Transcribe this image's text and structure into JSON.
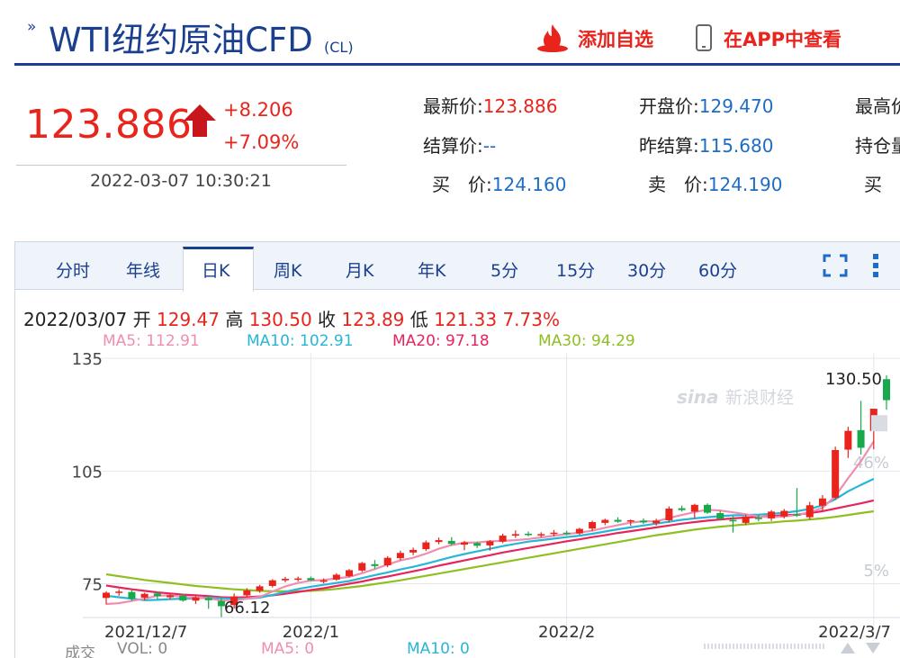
{
  "header": {
    "title": "WTI纽约原油CFD",
    "code": "(CL)",
    "add_watchlist": "添加自选",
    "view_in_app": "在APP中查看"
  },
  "quote": {
    "price": "123.886",
    "change": "+8.206",
    "change_pct": "+7.09%",
    "timestamp": "2022-03-07 10:30:21",
    "fields": [
      {
        "label": "最新价:",
        "value": "123.886",
        "red": true
      },
      {
        "label": "开盘价:",
        "value": "129.470",
        "red": false
      },
      {
        "label": "最高价",
        "value": "",
        "red": false
      },
      {
        "label": "结算价:",
        "value": "--",
        "red": false
      },
      {
        "label": "昨结算:",
        "value": "115.680",
        "red": false
      },
      {
        "label": "持仓量",
        "value": "",
        "red": false
      },
      {
        "label": "买　价:",
        "value": "124.160",
        "red": false
      },
      {
        "label": "卖　价:",
        "value": "124.190",
        "red": false
      },
      {
        "label": "买　量",
        "value": "",
        "red": false
      }
    ]
  },
  "tabs": [
    "分时",
    "年线",
    "日K",
    "周K",
    "月K",
    "年K",
    "5分",
    "15分",
    "30分",
    "60分"
  ],
  "active_tab": "日K",
  "icons": {
    "fullscreen": "fullscreen-icon",
    "more": "more-vertical-icon",
    "fire": "fire-icon",
    "phone": "phone-icon",
    "arrow": "up-arrow-icon"
  },
  "ohlc": {
    "date": "2022/03/07",
    "open_label": "开",
    "open": "129.47",
    "high_label": "高",
    "high": "130.50",
    "close_label": "收",
    "close": "123.89",
    "low_label": "低",
    "low": "121.33",
    "change_pct": "7.73%"
  },
  "ma_legend": [
    {
      "label": "MA5: 112.91",
      "color": "#f08eb0"
    },
    {
      "label": "MA10: 102.91",
      "color": "#27b6d6"
    },
    {
      "label": "MA20: 97.18",
      "color": "#e8245d"
    },
    {
      "label": "MA30: 94.29",
      "color": "#8fbf21"
    }
  ],
  "volume_legend": [
    {
      "label": "成交",
      "color": "#888888"
    },
    {
      "label": "VOL: 0",
      "color": "#888888"
    },
    {
      "label": "MA5: 0",
      "color": "#f08eb0"
    },
    {
      "label": "MA10: 0",
      "color": "#27b6d6"
    }
  ],
  "watermark": "新浪财经",
  "colors": {
    "up": "#e8241c",
    "down": "#18a94a",
    "brand": "#1b3f8f",
    "link": "#1f6cc5"
  },
  "chart_data": {
    "type": "candlestick",
    "y_ticks": [
      75,
      105,
      135
    ],
    "y_range": [
      66,
      136
    ],
    "pct_labels": [
      "46%",
      "5%"
    ],
    "x_labels": [
      {
        "label": "2021/12/7",
        "index": 0
      },
      {
        "label": "2022/1",
        "index": 16
      },
      {
        "label": "2022/2",
        "index": 36
      },
      {
        "label": "2022/3/7",
        "index": 60
      }
    ],
    "max_label": "130.50",
    "min_label": "66.12",
    "min_index": 9,
    "candles": [
      {
        "o": 71.2,
        "h": 73.0,
        "l": 69.5,
        "c": 72.6
      },
      {
        "o": 72.6,
        "h": 73.5,
        "l": 71.8,
        "c": 72.9
      },
      {
        "o": 72.8,
        "h": 73.4,
        "l": 70.4,
        "c": 71.0
      },
      {
        "o": 71.3,
        "h": 72.6,
        "l": 70.6,
        "c": 72.3
      },
      {
        "o": 72.4,
        "h": 72.8,
        "l": 70.9,
        "c": 71.7
      },
      {
        "o": 71.4,
        "h": 72.2,
        "l": 70.8,
        "c": 71.9
      },
      {
        "o": 71.8,
        "h": 72.3,
        "l": 70.2,
        "c": 70.5
      },
      {
        "o": 70.5,
        "h": 71.8,
        "l": 69.6,
        "c": 71.4
      },
      {
        "o": 71.2,
        "h": 71.7,
        "l": 68.3,
        "c": 70.6
      },
      {
        "o": 70.4,
        "h": 71.2,
        "l": 66.1,
        "c": 69.0
      },
      {
        "o": 69.3,
        "h": 72.4,
        "l": 68.4,
        "c": 71.6
      },
      {
        "o": 71.9,
        "h": 73.8,
        "l": 71.4,
        "c": 73.2
      },
      {
        "o": 73.1,
        "h": 74.7,
        "l": 72.6,
        "c": 74.3
      },
      {
        "o": 74.4,
        "h": 76.2,
        "l": 74.0,
        "c": 75.9
      },
      {
        "o": 75.9,
        "h": 76.8,
        "l": 75.4,
        "c": 76.3
      },
      {
        "o": 76.2,
        "h": 76.9,
        "l": 75.6,
        "c": 76.4
      },
      {
        "o": 76.5,
        "h": 76.9,
        "l": 75.8,
        "c": 75.9
      },
      {
        "o": 75.5,
        "h": 76.4,
        "l": 75.1,
        "c": 75.9
      },
      {
        "o": 76.1,
        "h": 77.8,
        "l": 75.8,
        "c": 77.4
      },
      {
        "o": 77.0,
        "h": 78.9,
        "l": 76.7,
        "c": 78.6
      },
      {
        "o": 78.5,
        "h": 80.8,
        "l": 78.1,
        "c": 80.5
      },
      {
        "o": 80.2,
        "h": 81.3,
        "l": 79.0,
        "c": 79.7
      },
      {
        "o": 79.9,
        "h": 82.3,
        "l": 79.4,
        "c": 81.9
      },
      {
        "o": 81.8,
        "h": 83.8,
        "l": 81.2,
        "c": 83.2
      },
      {
        "o": 83.3,
        "h": 84.6,
        "l": 82.6,
        "c": 84.0
      },
      {
        "o": 84.2,
        "h": 86.5,
        "l": 83.7,
        "c": 86.0
      },
      {
        "o": 86.1,
        "h": 87.3,
        "l": 85.5,
        "c": 86.6
      },
      {
        "o": 86.4,
        "h": 87.4,
        "l": 85.2,
        "c": 85.6
      },
      {
        "o": 85.4,
        "h": 86.4,
        "l": 83.9,
        "c": 86.0
      },
      {
        "o": 85.8,
        "h": 86.2,
        "l": 84.5,
        "c": 85.1
      },
      {
        "o": 85.2,
        "h": 86.6,
        "l": 83.8,
        "c": 86.3
      },
      {
        "o": 86.2,
        "h": 88.3,
        "l": 85.8,
        "c": 87.8
      },
      {
        "o": 87.8,
        "h": 89.2,
        "l": 87.2,
        "c": 88.2
      },
      {
        "o": 88.3,
        "h": 88.9,
        "l": 87.6,
        "c": 88.0
      },
      {
        "o": 88.1,
        "h": 88.7,
        "l": 87.3,
        "c": 88.2
      },
      {
        "o": 88.3,
        "h": 89.3,
        "l": 87.6,
        "c": 88.6
      },
      {
        "o": 88.6,
        "h": 89.1,
        "l": 87.9,
        "c": 88.5
      },
      {
        "o": 88.4,
        "h": 89.9,
        "l": 88.0,
        "c": 89.6
      },
      {
        "o": 89.7,
        "h": 91.8,
        "l": 89.0,
        "c": 91.4
      },
      {
        "o": 91.2,
        "h": 92.3,
        "l": 90.6,
        "c": 92.0
      },
      {
        "o": 92.0,
        "h": 92.7,
        "l": 91.2,
        "c": 91.5
      },
      {
        "o": 91.6,
        "h": 92.1,
        "l": 90.4,
        "c": 91.9
      },
      {
        "o": 91.8,
        "h": 92.4,
        "l": 90.9,
        "c": 91.3
      },
      {
        "o": 91.1,
        "h": 92.3,
        "l": 90.5,
        "c": 91.8
      },
      {
        "o": 91.9,
        "h": 95.6,
        "l": 91.3,
        "c": 95.0
      },
      {
        "o": 95.1,
        "h": 95.8,
        "l": 94.2,
        "c": 94.6
      },
      {
        "o": 94.2,
        "h": 96.3,
        "l": 92.4,
        "c": 96.0
      },
      {
        "o": 96.0,
        "h": 96.4,
        "l": 93.6,
        "c": 93.9
      },
      {
        "o": 93.8,
        "h": 94.4,
        "l": 91.8,
        "c": 92.3
      },
      {
        "o": 92.0,
        "h": 93.0,
        "l": 88.6,
        "c": 91.6
      },
      {
        "o": 91.2,
        "h": 93.4,
        "l": 90.6,
        "c": 92.9
      },
      {
        "o": 92.6,
        "h": 93.3,
        "l": 91.6,
        "c": 92.2
      },
      {
        "o": 92.4,
        "h": 94.6,
        "l": 91.7,
        "c": 94.2
      },
      {
        "o": 92.9,
        "h": 94.9,
        "l": 92.4,
        "c": 94.4
      },
      {
        "o": 93.5,
        "h": 100.5,
        "l": 92.8,
        "c": 93.1
      },
      {
        "o": 92.7,
        "h": 96.8,
        "l": 92.1,
        "c": 95.9
      },
      {
        "o": 95.8,
        "h": 98.6,
        "l": 94.1,
        "c": 97.7
      },
      {
        "o": 97.9,
        "h": 111.5,
        "l": 97.4,
        "c": 110.6
      },
      {
        "o": 110.7,
        "h": 116.8,
        "l": 108.5,
        "c": 115.7
      },
      {
        "o": 115.9,
        "h": 123.7,
        "l": 109.4,
        "c": 111.2
      },
      {
        "o": 115.7,
        "h": 120.6,
        "l": 110.8,
        "c": 121.6
      },
      {
        "o": 129.47,
        "h": 130.5,
        "l": 121.33,
        "c": 123.89
      }
    ],
    "ma": {
      "MA5": [
        69.6,
        69.8,
        70.4,
        71.0,
        71.8,
        71.9,
        71.5,
        71.2,
        71.1,
        70.5,
        70.5,
        71.0,
        71.5,
        72.9,
        74.3,
        75.2,
        75.8,
        76.0,
        76.4,
        76.8,
        77.8,
        78.9,
        80.1,
        81.2,
        81.9,
        83.0,
        84.3,
        85.3,
        85.9,
        86.0,
        86.3,
        86.4,
        86.6,
        86.9,
        87.3,
        87.8,
        88.2,
        88.6,
        89.1,
        89.9,
        90.6,
        91.3,
        91.6,
        91.6,
        92.5,
        93.3,
        94.1,
        94.7,
        94.5,
        94.0,
        93.5,
        92.9,
        92.7,
        92.9,
        93.3,
        94.0,
        95.2,
        98.3,
        103.1,
        107.6,
        112.91
      ],
      "MA10": [
        71.8,
        71.4,
        71.0,
        70.6,
        70.7,
        70.9,
        71.0,
        71.1,
        71.3,
        71.1,
        71.0,
        71.0,
        71.3,
        72.0,
        72.8,
        73.6,
        74.2,
        74.7,
        75.2,
        75.7,
        76.5,
        77.3,
        78.0,
        78.8,
        79.5,
        80.3,
        81.2,
        82.1,
        82.9,
        83.6,
        84.3,
        85.0,
        85.6,
        86.2,
        86.6,
        87.0,
        87.4,
        87.8,
        88.3,
        88.9,
        89.5,
        90.0,
        90.5,
        91.0,
        91.5,
        92.0,
        92.4,
        92.7,
        93.0,
        93.2,
        93.3,
        93.4,
        93.6,
        93.9,
        94.3,
        94.9,
        95.9,
        97.5,
        99.6,
        101.3,
        102.91
      ],
      "MA20": [
        74.5,
        74.0,
        73.5,
        73.1,
        72.7,
        72.4,
        72.1,
        71.9,
        71.7,
        71.4,
        71.3,
        71.4,
        71.6,
        71.9,
        72.3,
        72.8,
        73.3,
        73.8,
        74.4,
        75.0,
        75.6,
        76.3,
        76.9,
        77.6,
        78.3,
        79.0,
        79.8,
        80.5,
        81.2,
        81.9,
        82.6,
        83.3,
        83.9,
        84.5,
        85.1,
        85.7,
        86.3,
        86.8,
        87.4,
        87.9,
        88.5,
        89.0,
        89.5,
        90.0,
        90.5,
        91.0,
        91.4,
        91.8,
        92.1,
        92.4,
        92.6,
        92.8,
        93.0,
        93.2,
        93.4,
        93.8,
        94.3,
        95.0,
        95.7,
        96.4,
        97.18
      ],
      "MA30": [
        77.5,
        77.0,
        76.5,
        76.0,
        75.6,
        75.2,
        74.8,
        74.4,
        74.1,
        73.8,
        73.5,
        73.3,
        73.1,
        73.0,
        73.0,
        73.0,
        73.1,
        73.3,
        73.6,
        74.0,
        74.4,
        74.9,
        75.4,
        75.9,
        76.5,
        77.1,
        77.7,
        78.3,
        78.9,
        79.5,
        80.1,
        80.7,
        81.3,
        81.9,
        82.5,
        83.1,
        83.7,
        84.3,
        84.9,
        85.5,
        86.1,
        86.7,
        87.3,
        87.9,
        88.4,
        88.9,
        89.4,
        89.8,
        90.2,
        90.5,
        90.8,
        91.1,
        91.3,
        91.6,
        91.8,
        92.1,
        92.4,
        92.8,
        93.3,
        93.8,
        94.29
      ]
    }
  }
}
